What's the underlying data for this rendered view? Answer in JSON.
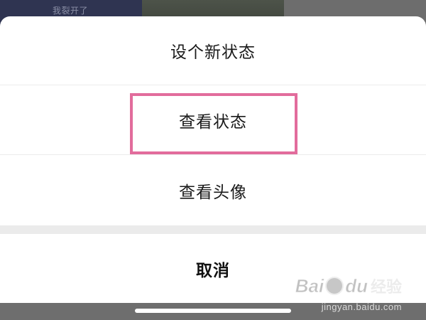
{
  "background": {
    "thumb_caption": "我裂开了"
  },
  "action_sheet": {
    "options": [
      {
        "label": "设个新状态"
      },
      {
        "label": "查看状态"
      },
      {
        "label": "查看头像"
      }
    ],
    "cancel_label": "取消",
    "highlight_color": "#e26c9c"
  },
  "watermark": {
    "logo_left": "Bai",
    "logo_right": "du",
    "logo_cn": "经验",
    "url": "jingyan.baidu.com"
  }
}
